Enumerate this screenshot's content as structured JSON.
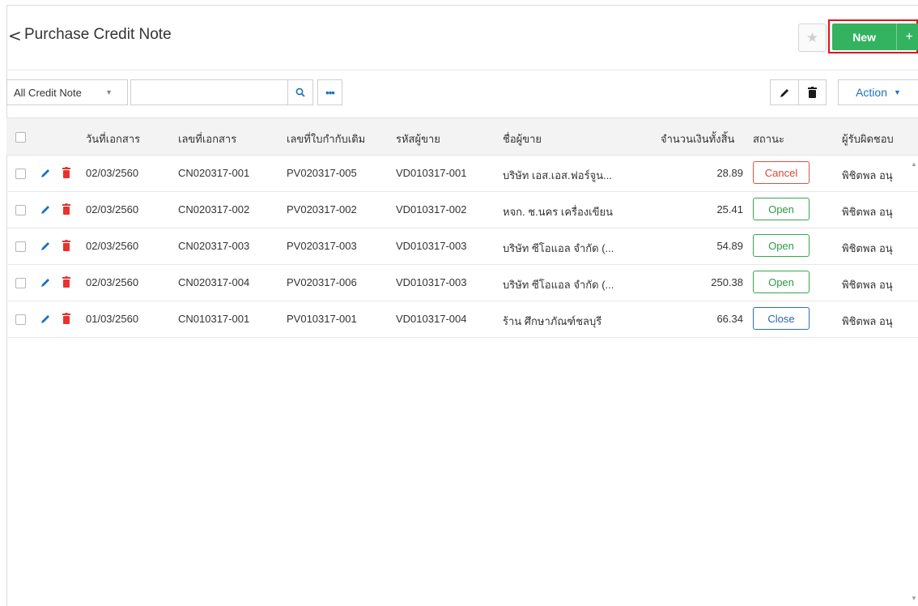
{
  "header": {
    "back_glyph": "<",
    "title": "Purchase Credit Note",
    "new_label": "New",
    "new_plus": "+"
  },
  "toolbar": {
    "filter_value": "All Credit Note",
    "search_placeholder": "",
    "action_label": "Action"
  },
  "table": {
    "columns": [
      "วันที่เอกสาร",
      "เลขที่เอกสาร",
      "เลขที่ใบกำกับเดิม",
      "รหัสผู้ขาย",
      "ชื่อผู้ขาย",
      "จำนวนเงินทั้งสิ้น",
      "สถานะ",
      "ผู้รับผิดชอบ"
    ],
    "rows": [
      {
        "date": "02/03/2560",
        "doc_no": "CN020317-001",
        "ref_no": "PV020317-005",
        "vendor_code": "VD010317-001",
        "vendor_name": "บริษัท เอส.เอส.ฟอร์จูน...",
        "amount": "28.89",
        "status": "Cancel",
        "owner": "พิชิตพล อนุ"
      },
      {
        "date": "02/03/2560",
        "doc_no": "CN020317-002",
        "ref_no": "PV020317-002",
        "vendor_code": "VD010317-002",
        "vendor_name": "หจก. ช.นคร เครื่องเขียน",
        "amount": "25.41",
        "status": "Open",
        "owner": "พิชิตพล อนุ"
      },
      {
        "date": "02/03/2560",
        "doc_no": "CN020317-003",
        "ref_no": "PV020317-003",
        "vendor_code": "VD010317-003",
        "vendor_name": "บริษัท ซีโอแอล จำกัด (...",
        "amount": "54.89",
        "status": "Open",
        "owner": "พิชิตพล อนุ"
      },
      {
        "date": "02/03/2560",
        "doc_no": "CN020317-004",
        "ref_no": "PV020317-006",
        "vendor_code": "VD010317-003",
        "vendor_name": "บริษัท ซีโอแอล จำกัด (...",
        "amount": "250.38",
        "status": "Open",
        "owner": "พิชิตพล อนุ"
      },
      {
        "date": "01/03/2560",
        "doc_no": "CN010317-001",
        "ref_no": "PV010317-001",
        "vendor_code": "VD010317-004",
        "vendor_name": "ร้าน ศึกษาภัณฑ์ชลบุรี",
        "amount": "66.34",
        "status": "Close",
        "owner": "พิชิตพล อนุ"
      }
    ]
  },
  "colors": {
    "new_button": "#33b25f",
    "highlight": "#e0141b",
    "accent_blue": "#1a73c2",
    "delete_red": "#e8322e"
  },
  "icons": [
    "back-icon",
    "star-icon",
    "plus-icon",
    "search-icon",
    "more-icon",
    "pencil-icon",
    "trash-icon",
    "caret-down-icon"
  ]
}
